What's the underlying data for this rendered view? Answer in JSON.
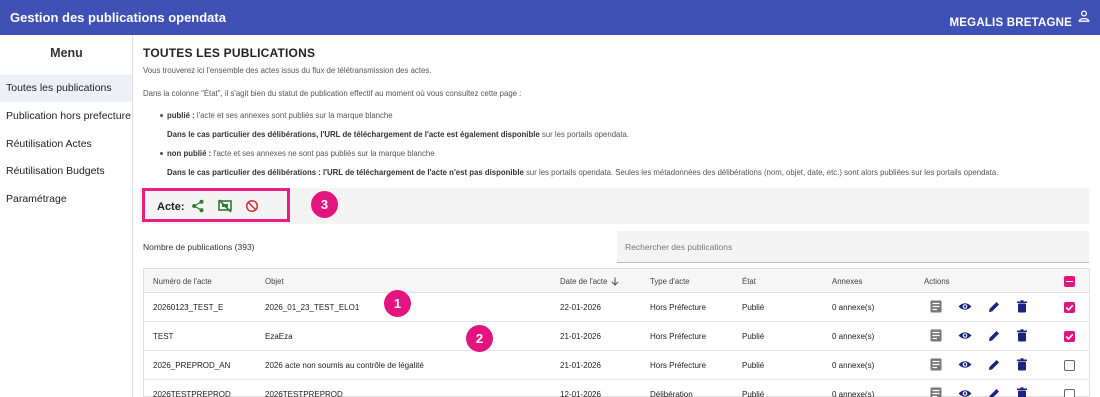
{
  "header": {
    "app_title": "Gestion des publications opendata",
    "organization": "MEGALIS BRETAGNE",
    "user_icon": "person-icon"
  },
  "sidebar": {
    "title": "Menu",
    "items": [
      {
        "label": "Toutes les publications",
        "active": true
      },
      {
        "label": "Publication hors prefecture",
        "active": false
      },
      {
        "label": "Réutilisation Actes",
        "active": false
      },
      {
        "label": "Réutilisation Budgets",
        "active": false
      },
      {
        "label": "Paramétrage",
        "active": false
      }
    ]
  },
  "page": {
    "title": "TOUTES LES PUBLICATIONS",
    "intro": "Vous trouverez ici l'ensemble des actes issus du flux de télétransmission des actes.",
    "etat_intro": "Dans la colonne \"État\", il s'agit bien du statut de publication effectif au moment où vous consultez cette page :",
    "publie_term": "publié :",
    "publie_desc": " l'acte et ses annexes sont publiés sur la marque blanche",
    "publie_note_bold": "Dans le cas particulier des délibérations, l'URL de téléchargement de l'acte est également disponible",
    "publie_note_rest": " sur les portails opendata.",
    "nonpublie_term": "non publié :",
    "nonpublie_desc": " l'acte et ses annexes ne sont pas publiés sur la marque blanche",
    "nonpublie_note_bold": "Dans le cas particulier des délibérations : l'URL de téléchargement de l'acte n'est pas disponible",
    "nonpublie_note_rest": " sur les portails opendata. Seules les métadonnées des délibérations (nom, objet, date, etc.) sont alors publiées sur les portails opendata."
  },
  "actions_bar": {
    "label": "Acte:",
    "icons": [
      "share-icon",
      "unpublish-icon",
      "block-icon"
    ]
  },
  "annotations": [
    "1",
    "2",
    "3"
  ],
  "count_label": "Nombre de publications (393)",
  "search": {
    "placeholder": "Rechercher des publications"
  },
  "table": {
    "columns": [
      "Numéro de l'acte",
      "Objet",
      "Date de l'acte",
      "Type d'acte",
      "État",
      "Annexes",
      "Actions"
    ],
    "sort_icon": "arrow-down-icon",
    "rows": [
      {
        "numero": "20260123_TEST_E",
        "objet": "2026_01_23_TEST_ELO1",
        "date": "22-01-2026",
        "type": "Hors Préfecture",
        "etat": "Publié",
        "annexes": "0 annexe(s)",
        "checked": true
      },
      {
        "numero": "TEST",
        "objet": "EzaEza",
        "date": "21-01-2026",
        "type": "Hors Préfecture",
        "etat": "Publié",
        "annexes": "0 annexe(s)",
        "checked": true
      },
      {
        "numero": "2026_PREPROD_AN",
        "objet": "2026 acte non soumis au contrôle de légalité",
        "date": "21-01-2026",
        "type": "Hors Préfecture",
        "etat": "Publié",
        "annexes": "0 annexe(s)",
        "checked": false
      },
      {
        "numero": "2026TESTPREPROD",
        "objet": "2026TESTPREPROD",
        "date": "12-01-2026",
        "type": "Délibération",
        "etat": "Publié",
        "annexes": "0 annexe(s)",
        "checked": false
      }
    ]
  },
  "colors": {
    "primary": "#3f51b5",
    "accent": "#e2157e",
    "action_icon": "#1a237e",
    "share": "#2e7d32",
    "block": "#d32f2f"
  }
}
